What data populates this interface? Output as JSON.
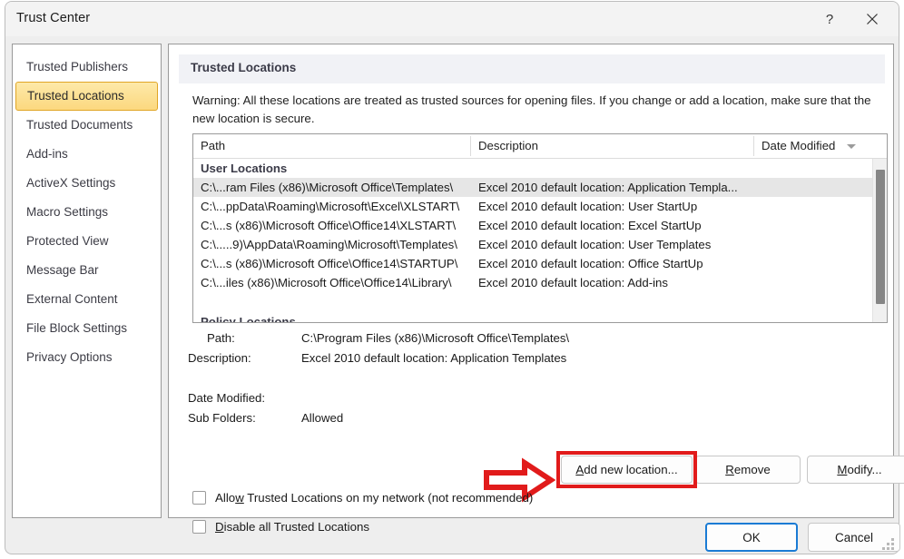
{
  "window": {
    "title": "Trust Center",
    "help_icon": "question-mark-icon",
    "close_icon": "close-icon"
  },
  "sidebar": {
    "items": [
      {
        "label": "Trusted Publishers",
        "selected": false
      },
      {
        "label": "Trusted Locations",
        "selected": true
      },
      {
        "label": "Trusted Documents",
        "selected": false
      },
      {
        "label": "Add-ins",
        "selected": false
      },
      {
        "label": "ActiveX Settings",
        "selected": false
      },
      {
        "label": "Macro Settings",
        "selected": false
      },
      {
        "label": "Protected View",
        "selected": false
      },
      {
        "label": "Message Bar",
        "selected": false
      },
      {
        "label": "External Content",
        "selected": false
      },
      {
        "label": "File Block Settings",
        "selected": false
      },
      {
        "label": "Privacy Options",
        "selected": false
      }
    ]
  },
  "pane": {
    "section_title": "Trusted Locations",
    "warning": "Warning: All these locations are treated as trusted sources for opening files.  If you change or add a location, make sure that the new location is secure.",
    "list": {
      "columns": [
        "Path",
        "Description",
        "Date Modified"
      ],
      "sort_indicator": "sort-descending-icon",
      "groups": [
        {
          "name": "User Locations",
          "rows": [
            {
              "path": "C:\\...ram Files (x86)\\Microsoft Office\\Templates\\",
              "description": "Excel 2010 default location: Application Templa...",
              "selected": true
            },
            {
              "path": "C:\\...ppData\\Roaming\\Microsoft\\Excel\\XLSTART\\",
              "description": "Excel 2010 default location: User StartUp",
              "selected": false
            },
            {
              "path": "C:\\...s (x86)\\Microsoft Office\\Office14\\XLSTART\\",
              "description": "Excel 2010 default location: Excel StartUp",
              "selected": false
            },
            {
              "path": "C:\\.....9)\\AppData\\Roaming\\Microsoft\\Templates\\",
              "description": "Excel 2010 default location: User Templates",
              "selected": false
            },
            {
              "path": "C:\\...s (x86)\\Microsoft Office\\Office14\\STARTUP\\",
              "description": "Excel 2010 default location: Office StartUp",
              "selected": false
            },
            {
              "path": "C:\\...iles (x86)\\Microsoft Office\\Office14\\Library\\",
              "description": "Excel 2010 default location: Add-ins",
              "selected": false
            }
          ]
        },
        {
          "name": "Policy Locations",
          "rows": []
        }
      ]
    },
    "details": {
      "path_label": "Path:",
      "path_value": "C:\\Program Files (x86)\\Microsoft Office\\Templates\\",
      "description_label": "Description:",
      "description_value": "Excel 2010 default location: Application Templates",
      "date_modified_label": "Date Modified:",
      "date_modified_value": "",
      "sub_folders_label": "Sub Folders:",
      "sub_folders_value": "Allowed"
    },
    "buttons": {
      "add": {
        "pre": "A",
        "accel": "",
        "rest": "dd new location..."
      },
      "add_full": "Add new location...",
      "remove_pre": "",
      "remove_accel": "R",
      "remove_rest": "emove",
      "modify_pre": "",
      "modify_accel": "M",
      "modify_rest": "odify..."
    },
    "checkboxes": [
      {
        "pre": "Allo",
        "accel": "w",
        "rest": " Trusted Locations on my network (not recommended)",
        "checked": false
      },
      {
        "pre": "",
        "accel": "D",
        "rest": "isable all Trusted Locations",
        "checked": false
      }
    ]
  },
  "footer": {
    "ok_label": "OK",
    "cancel_label": "Cancel"
  },
  "annotation": {
    "arrow_color": "#e11b1b",
    "box_color": "#e11b1b",
    "target": "Add new location..."
  }
}
